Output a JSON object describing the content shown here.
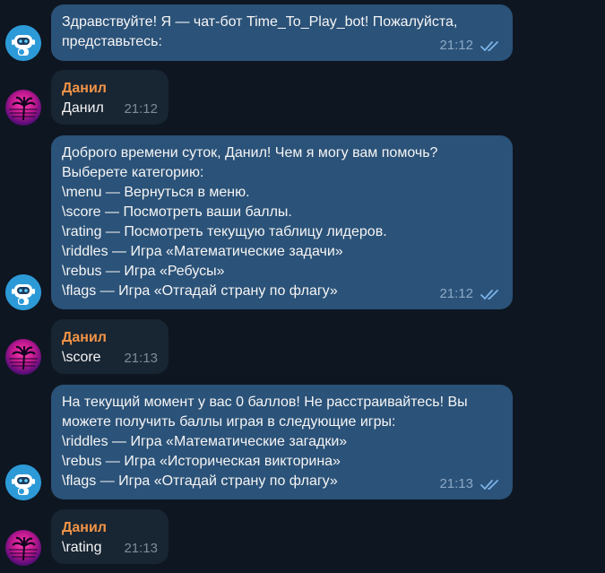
{
  "messages": [
    {
      "sender": "bot",
      "lines": [
        "Здравствуйте! Я — чат-бот Time_To_Play_bot! Пожалуйста,",
        "представьтесь:"
      ],
      "time": "21:12",
      "read": true
    },
    {
      "sender": "user",
      "name": "Данил",
      "text": "Данил",
      "time": "21:12"
    },
    {
      "sender": "bot",
      "lines": [
        "Доброго времени суток, Данил! Чем я могу вам помочь?",
        "Выберете категорию:",
        "\\menu — Вернуться в меню.",
        "\\score — Посмотреть ваши баллы.",
        "\\rating — Посмотреть текущую таблицу лидеров.",
        "\\riddles — Игра «Математические задачи»",
        "\\rebus — Игра «Ребусы»",
        "\\flags — Игра «Отгадай страну по флагу»"
      ],
      "time": "21:12",
      "read": true
    },
    {
      "sender": "user",
      "name": "Данил",
      "text": "\\score",
      "time": "21:13"
    },
    {
      "sender": "bot",
      "lines": [
        "На текущий момент у вас 0 баллов! Не расстраивайтесь! Вы",
        "можете получить баллы играя в следующие игры:",
        "\\riddles — Игра «Математические загадки»",
        "\\rebus — Игра «Историческая викторина»",
        "\\flags — Игра «Отгадай страну по флагу»"
      ],
      "time": "21:13",
      "read": true
    },
    {
      "sender": "user",
      "name": "Данил",
      "text": "\\rating",
      "time": "21:13"
    }
  ],
  "colors": {
    "background": "#0e1621",
    "bot_bubble": "#2b5278",
    "user_bubble": "#182533",
    "sender_name": "#f29446",
    "bot_avatar": "#2d9ad8"
  },
  "icons": {
    "bot_avatar": "robot-icon",
    "user_avatar": "palm-sunset-icon",
    "read_status": "double-check-icon"
  }
}
